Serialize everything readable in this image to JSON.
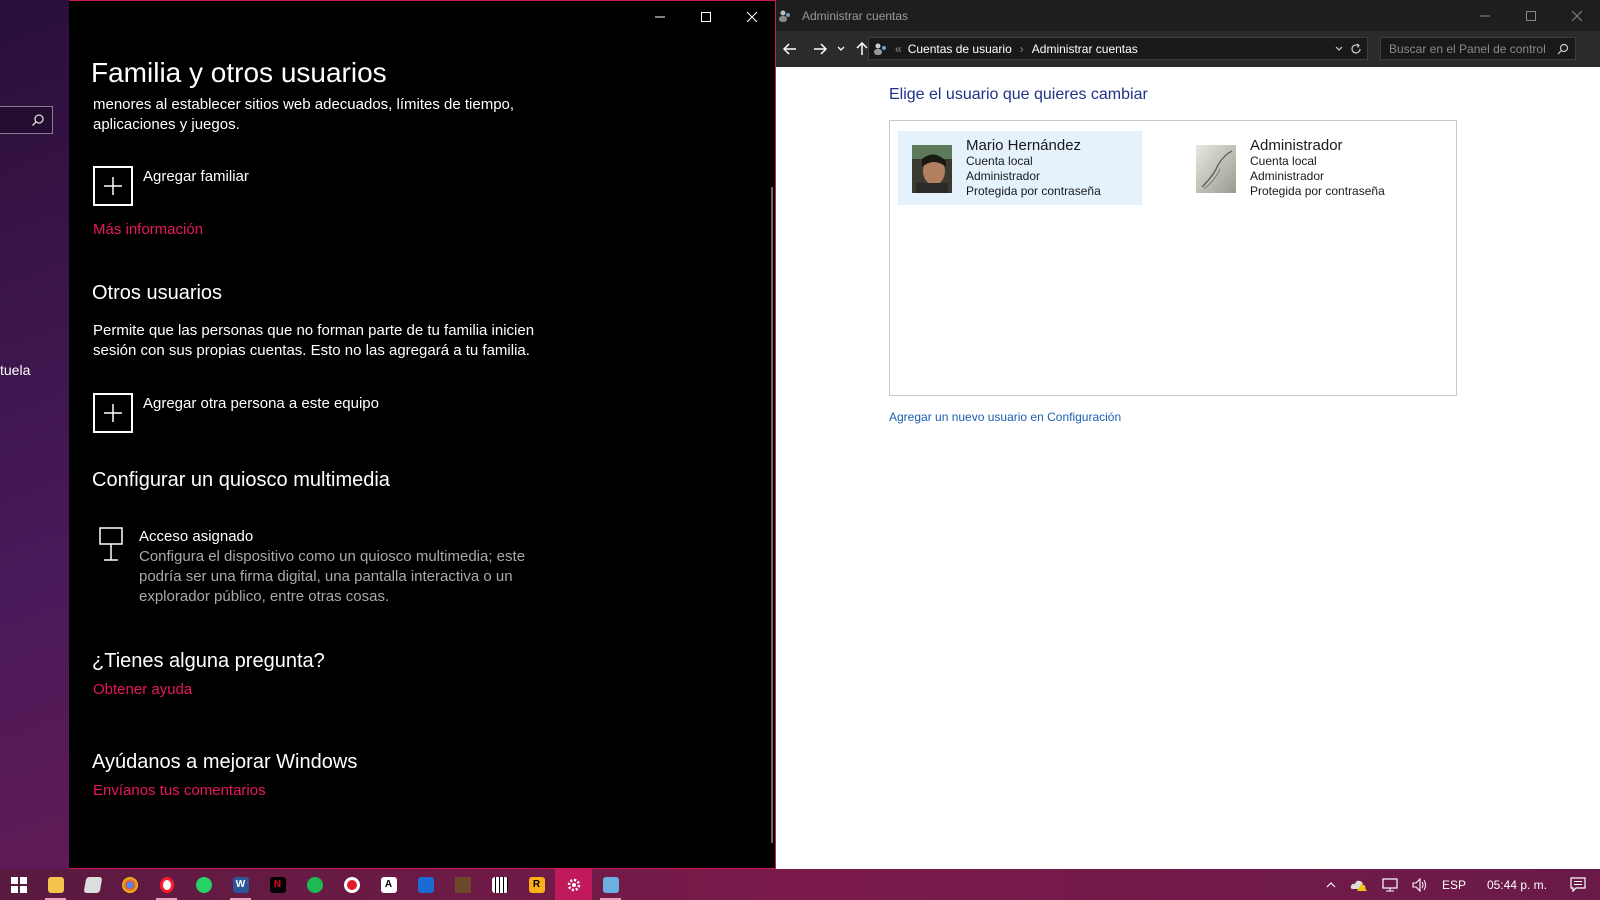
{
  "desktop": {
    "partial_text": "tuela"
  },
  "settings": {
    "title": "Familia y otros usuarios",
    "intro_text": "menores al establecer sitios web adecuados, límites de tiempo, aplicaciones y juegos.",
    "add_family_label": "Agregar familiar",
    "more_info_link": "Más información",
    "other_users_heading": "Otros usuarios",
    "other_users_text": "Permite que las personas que no forman parte de tu familia inicien sesión con sus propias cuentas. Esto no las agregará a tu familia.",
    "add_other_label": "Agregar otra persona a este equipo",
    "kiosk_heading": "Configurar un quiosco multimedia",
    "kiosk_title": "Acceso asignado",
    "kiosk_desc": "Configura el dispositivo como un quiosco multimedia; este podría ser una firma digital, una pantalla interactiva o un explorador público, entre otras cosas.",
    "question_heading": "¿Tienes alguna pregunta?",
    "help_link": "Obtener ayuda",
    "improve_heading": "Ayúdanos a mejorar Windows",
    "feedback_link": "Envíanos tus comentarios",
    "accent": "#e8175d"
  },
  "control_panel": {
    "window_title": "Administrar cuentas",
    "breadcrumb": [
      "Cuentas de usuario",
      "Administrar cuentas"
    ],
    "search_placeholder": "Buscar en el Panel de control",
    "heading": "Elige el usuario que quieres cambiar",
    "users": [
      {
        "name": "Mario Hernández",
        "type": "Cuenta local",
        "role": "Administrador",
        "status": "Protegida por contraseña",
        "selected": true
      },
      {
        "name": "Administrador",
        "type": "Cuenta local",
        "role": "Administrador",
        "status": "Protegida por contraseña",
        "selected": false
      }
    ],
    "add_user_link": "Agregar un nuevo usuario en Configuración"
  },
  "taskbar": {
    "apps": [
      "start-icon",
      "file-explorer-icon",
      "notes-icon",
      "chrome-icon",
      "opera-icon",
      "whatsapp-icon",
      "word-icon",
      "netflix-icon",
      "spotify-icon",
      "recorder-icon",
      "ai-icon",
      "app-blue-icon",
      "minecraft-icon",
      "piano-icon",
      "rockstar-icon",
      "settings-icon",
      "control-panel-icon"
    ],
    "language": "ESP",
    "time": "05:44 p. m."
  }
}
